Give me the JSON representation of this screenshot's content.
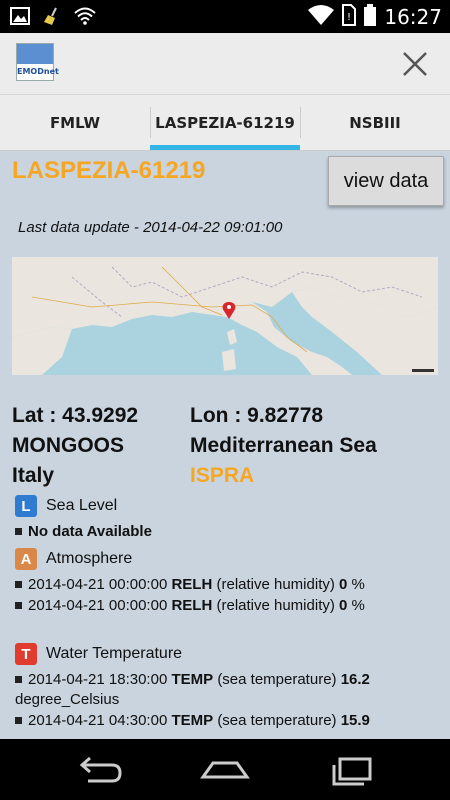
{
  "status_bar": {
    "time": "16:27",
    "icons": [
      "image-icon",
      "broom-icon",
      "wifi-icon",
      "wifi-signal-icon",
      "no-sim-icon",
      "battery-icon"
    ]
  },
  "action_bar": {
    "logo_text": "EMODnet",
    "close_icon": "close-icon"
  },
  "tabs": [
    {
      "label": "FMLW",
      "active": false
    },
    {
      "label": "LASPEZIA-61219",
      "active": true
    },
    {
      "label": "NSBIII",
      "active": false
    }
  ],
  "station": {
    "title": "LASPEZIA-61219",
    "view_data_label": "view data",
    "last_update": "Last data update - 2014-04-22 09:01:00",
    "lat": "Lat : 43.9292",
    "lon": "Lon : 9.82778",
    "network": "MONGOOS",
    "sea": "Mediterranean Sea",
    "country": "Italy",
    "institution": "ISPRA"
  },
  "sections": [
    {
      "badge": "L",
      "title": "Sea Level",
      "lines": [
        {
          "text": "No data Available",
          "bold": true
        }
      ]
    },
    {
      "badge": "A",
      "title": "Atmosphere",
      "lines": [
        {
          "date": "2014-04-21 00:00:00",
          "param": "RELH",
          "desc": "(relative humidity)",
          "value": "0",
          "unit": "%"
        },
        {
          "date": "2014-04-21 00:00:00",
          "param": "RELH",
          "desc": "(relative humidity)",
          "value": "0",
          "unit": "%"
        }
      ]
    },
    {
      "badge": "T",
      "title": "Water Temperature",
      "lines": [
        {
          "date": "2014-04-21 18:30:00",
          "param": "TEMP",
          "desc": "(sea temperature)",
          "value": "16.2",
          "unit": "degree_Celsius"
        },
        {
          "date": "2014-04-21 04:30:00",
          "param": "TEMP",
          "desc": "(sea temperature)",
          "value": "15.9",
          "unit": ""
        }
      ]
    }
  ],
  "nav_bar": {
    "icons": [
      "back-icon",
      "home-icon",
      "recent-apps-icon"
    ]
  },
  "colors": {
    "accent": "#33b5e5",
    "title_orange": "#f5a623",
    "content_bg": "#c9d4df"
  }
}
